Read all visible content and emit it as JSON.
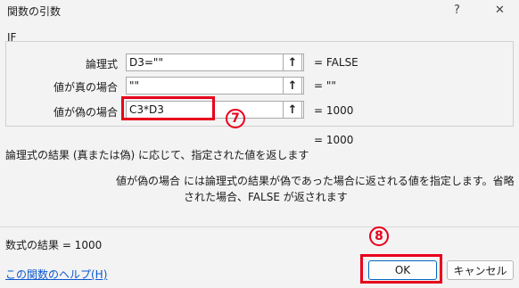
{
  "window": {
    "title": "関数の引数",
    "help_glyph": "?",
    "close_glyph": "✕"
  },
  "function_name": "IF",
  "args": [
    {
      "label": "論理式",
      "value": "D3=\"\"",
      "result": "= FALSE"
    },
    {
      "label": "値が真の場合",
      "value": "\"\"",
      "result": "= \"\""
    },
    {
      "label": "値が偽の場合",
      "value": "C3*D3",
      "result": "= 1000"
    }
  ],
  "ref_glyph": "↑",
  "overall_result": "= 1000",
  "description": "論理式の結果 (真または偽) に応じて、指定された値を返します",
  "arg_help": {
    "name": "値が偽の場合",
    "text": "には論理式の結果が偽であった場合に返される値を指定します。省略された場合、FALSE が返されます"
  },
  "formula_result": "数式の結果 =   1000",
  "help_link": "この関数のヘルプ(H)",
  "buttons": {
    "ok": "OK",
    "cancel": "キャンセル"
  },
  "annotations": {
    "step7": "7",
    "step8": "8"
  },
  "colors": {
    "highlight": "#e8001b",
    "link": "#0b57d0",
    "primary_border": "#0067c0"
  }
}
